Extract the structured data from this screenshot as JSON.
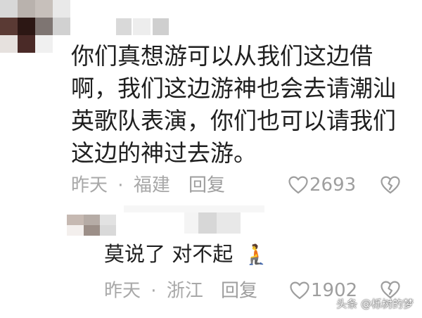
{
  "comment": {
    "lines": [
      "你们真想游可以从我们这边借",
      "啊，我们这边游神也会去请潮汕",
      "英歌队表演，你们也可以请我们",
      "这边的神过去游。"
    ],
    "time": "昨天",
    "separator": "·",
    "location": "福建",
    "reply_label": "回复",
    "like_count": "2693"
  },
  "reply": {
    "text": "莫说了 对不起",
    "emoji": "🧎",
    "time": "昨天",
    "separator": "·",
    "location": "浙江",
    "reply_label": "回复",
    "like_count": "1902"
  },
  "watermark": {
    "text": "头条 @栎树的梦"
  },
  "colors": {
    "text": "#1f1f1f",
    "meta": "#a8a8a8",
    "icon": "#9e9e9e"
  },
  "icons": {
    "like": "heart-outline-icon",
    "dislike": "broken-heart-outline-icon"
  }
}
